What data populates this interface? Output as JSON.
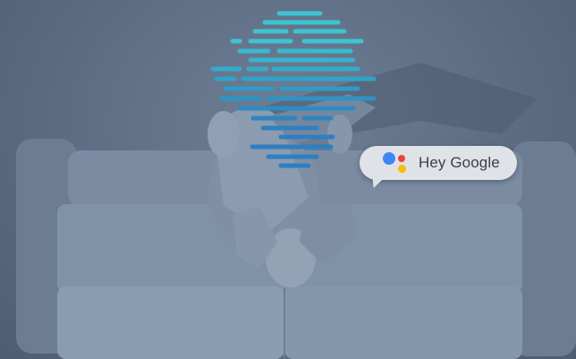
{
  "assistant": {
    "hotword_text": "Hey Google",
    "logo_icon": "google-assistant-icon"
  },
  "colors": {
    "background": "#5b6b81",
    "bubble": "#dfe3e8",
    "bubble_text": "#3c4043",
    "wave_light": "#3ec3d3",
    "wave_mid": "#2fa7c9",
    "wave_dark": "#2e7fc1",
    "dot_blue": "#4285f4",
    "dot_red": "#ea4335",
    "dot_yellow": "#fbbc05"
  }
}
